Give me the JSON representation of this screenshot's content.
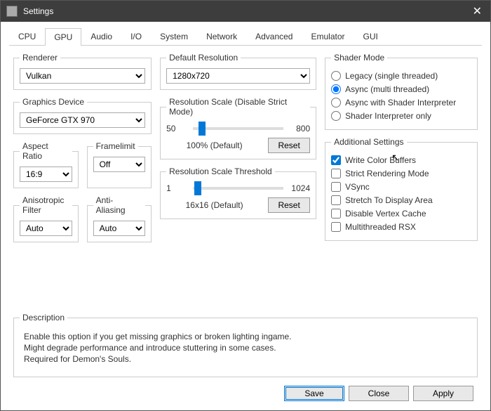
{
  "window": {
    "title": "Settings",
    "close_glyph": "✕"
  },
  "tabs": [
    "CPU",
    "GPU",
    "Audio",
    "I/O",
    "System",
    "Network",
    "Advanced",
    "Emulator",
    "GUI"
  ],
  "active_tab": "GPU",
  "renderer": {
    "legend": "Renderer",
    "value": "Vulkan"
  },
  "graphics_device": {
    "legend": "Graphics Device",
    "value": "GeForce GTX 970"
  },
  "aspect_ratio": {
    "legend": "Aspect Ratio",
    "value": "16:9"
  },
  "framelimit": {
    "legend": "Framelimit",
    "value": "Off"
  },
  "anisotropic": {
    "legend": "Anisotropic Filter",
    "value": "Auto"
  },
  "antialias": {
    "legend": "Anti-Aliasing",
    "value": "Auto"
  },
  "default_resolution": {
    "legend": "Default Resolution",
    "value": "1280x720"
  },
  "res_scale": {
    "legend": "Resolution Scale (Disable Strict Mode)",
    "min": "50",
    "max": "800",
    "value_text": "100% (Default)",
    "reset": "Reset"
  },
  "res_threshold": {
    "legend": "Resolution Scale Threshold",
    "min": "1",
    "max": "1024",
    "value_text": "16x16 (Default)",
    "reset": "Reset"
  },
  "shader_mode": {
    "legend": "Shader Mode",
    "options": [
      {
        "label": "Legacy (single threaded)",
        "checked": false
      },
      {
        "label": "Async (multi threaded)",
        "checked": true
      },
      {
        "label": "Async with Shader Interpreter",
        "checked": false
      },
      {
        "label": "Shader Interpreter only",
        "checked": false
      }
    ]
  },
  "additional": {
    "legend": "Additional Settings",
    "items": [
      {
        "label": "Write Color Buffers",
        "checked": true
      },
      {
        "label": "Strict Rendering Mode",
        "checked": false
      },
      {
        "label": "VSync",
        "checked": false
      },
      {
        "label": "Stretch To Display Area",
        "checked": false
      },
      {
        "label": "Disable Vertex Cache",
        "checked": false
      },
      {
        "label": "Multithreaded RSX",
        "checked": false
      }
    ]
  },
  "description": {
    "legend": "Description",
    "text": "Enable this option if you get missing graphics or broken lighting ingame.\nMight degrade performance and introduce stuttering in some cases.\nRequired for Demon's Souls."
  },
  "footer": {
    "save": "Save",
    "close": "Close",
    "apply": "Apply"
  }
}
